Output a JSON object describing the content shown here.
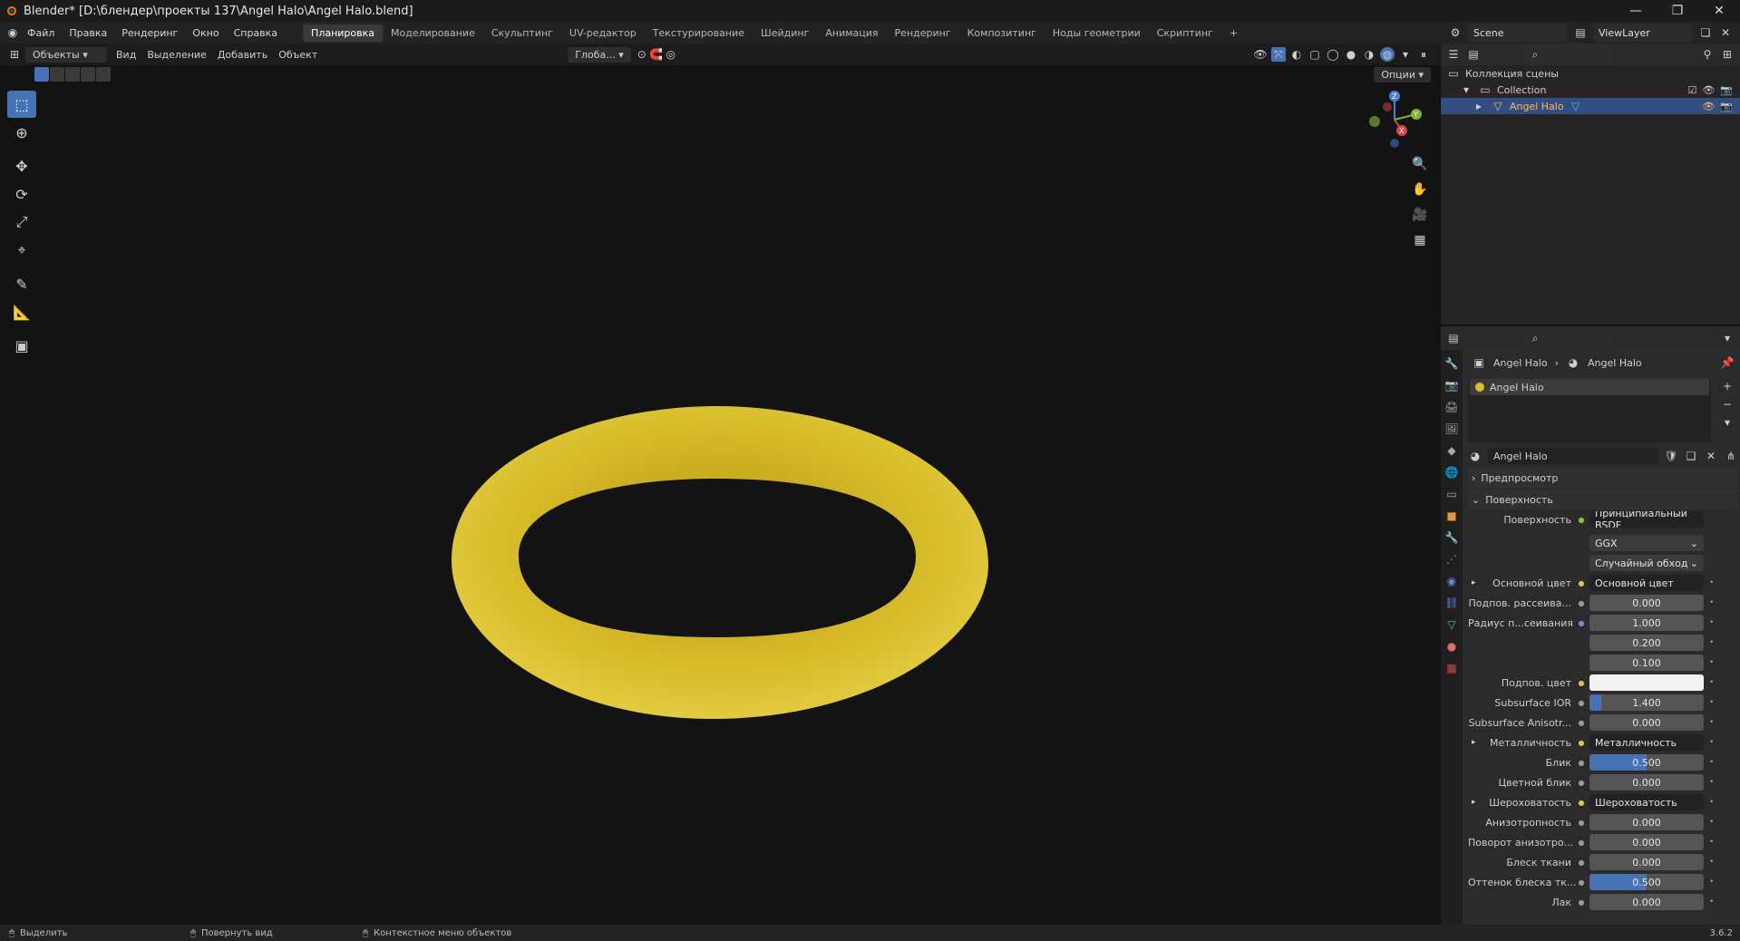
{
  "window": {
    "title": "Blender* [D:\\блендер\\проекты 137\\Angel Halo\\Angel Halo.blend]"
  },
  "menu": [
    "Файл",
    "Правка",
    "Рендеринг",
    "Окно",
    "Справка"
  ],
  "workspaces": [
    "Планировка",
    "Моделирование",
    "Скульптинг",
    "UV-редактор",
    "Текстурирование",
    "Шейдинг",
    "Анимация",
    "Рендеринг",
    "Композитинг",
    "Ноды геометрии",
    "Скриптинг",
    "+"
  ],
  "scene": {
    "name": "Scene",
    "view_layer": "ViewLayer"
  },
  "viewport": {
    "mode": "Объекты",
    "menus": [
      "Вид",
      "Выделение",
      "Добавить",
      "Объект"
    ],
    "orientation": "Глоба...",
    "options": "Опции",
    "gizmo": {
      "x": "X",
      "y": "Y",
      "z": "Z"
    },
    "halo_color": "#d9bf2c"
  },
  "outliner": {
    "rows": [
      {
        "label": "Коллекция сцены"
      },
      {
        "label": "Collection"
      },
      {
        "label": "Angel Halo"
      }
    ]
  },
  "properties": {
    "breadcrumb": [
      "Angel Halo",
      "Angel Halo"
    ],
    "slot": "Angel Halo",
    "material_name": "Angel Halo",
    "panels": {
      "preview": "Предпросмотр",
      "surface": "Поверхность"
    },
    "surface_shader": "Принципиальный BSDF",
    "distribution": "GGX",
    "subsurface_method": "Случайный обход",
    "rows": [
      {
        "label": "Основной цвет",
        "value": "Основной цвет",
        "kind": "link",
        "expand": true
      },
      {
        "label": "Подпов. рассеива...",
        "value": "0.000",
        "kind": "num"
      },
      {
        "label": "Радиус п...сеивания",
        "value": "1.000",
        "kind": "num"
      },
      {
        "label": "",
        "value": "0.200",
        "kind": "num"
      },
      {
        "label": "",
        "value": "0.100",
        "kind": "num"
      },
      {
        "label": "Подпов. цвет",
        "value": "",
        "kind": "color"
      },
      {
        "label": "Subsurface IOR",
        "value": "1.400",
        "kind": "num",
        "fill": 0.1
      },
      {
        "label": "Subsurface Anisotr...",
        "value": "0.000",
        "kind": "num"
      },
      {
        "label": "Металличность",
        "value": "Металличность",
        "kind": "link",
        "expand": true
      },
      {
        "label": "Блик",
        "value": "0.500",
        "kind": "num",
        "fill": 0.5
      },
      {
        "label": "Цветной блик",
        "value": "0.000",
        "kind": "num"
      },
      {
        "label": "Шероховатость",
        "value": "Шероховатость",
        "kind": "link",
        "expand": true
      },
      {
        "label": "Анизотропность",
        "value": "0.000",
        "kind": "num"
      },
      {
        "label": "Поворот анизотро...",
        "value": "0.000",
        "kind": "num"
      },
      {
        "label": "Блеск ткани",
        "value": "0.000",
        "kind": "num"
      },
      {
        "label": "Оттенок блеска тк...",
        "value": "0.500",
        "kind": "num",
        "fill": 0.5
      },
      {
        "label": "Лак",
        "value": "0.000",
        "kind": "num"
      }
    ]
  },
  "status": {
    "left": "Выделить",
    "middle": "Повернуть вид",
    "right": "Контекстное меню объектов",
    "version": "3.6.2"
  }
}
